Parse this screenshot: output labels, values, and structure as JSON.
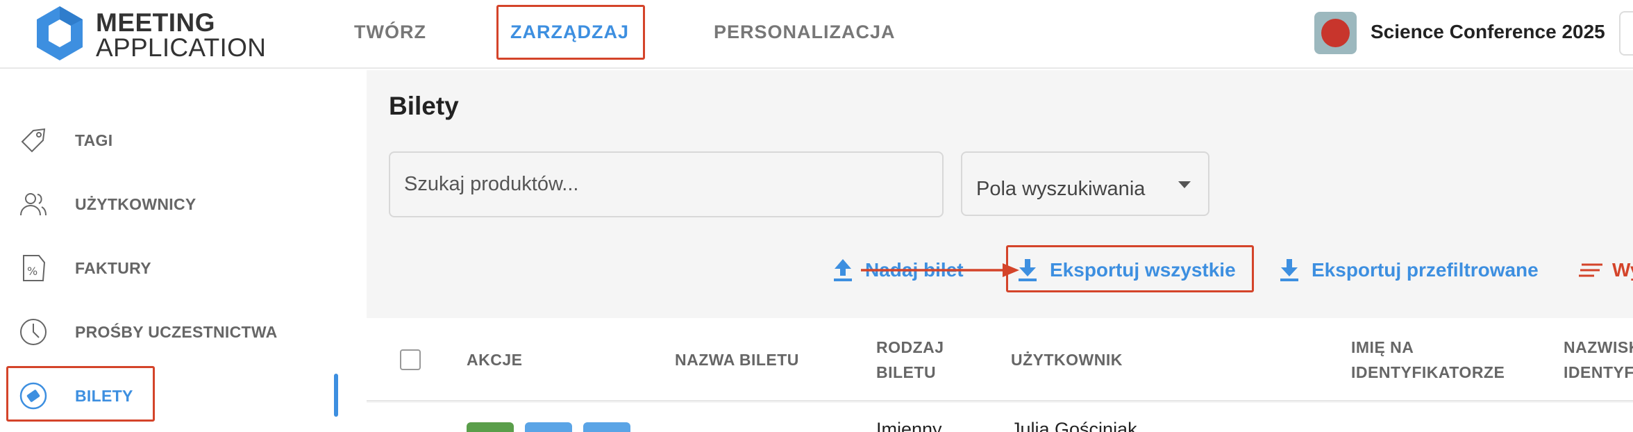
{
  "logo": {
    "line1": "MEETING",
    "line2": "APPLICATION"
  },
  "nav": {
    "tworz": "TWÓRZ",
    "zarzadzaj": "ZARZĄDZAJ",
    "personalizacja": "PERSONALIZACJA"
  },
  "conference": {
    "name": "Science Conference 2025"
  },
  "sidebar": {
    "items": [
      {
        "label": "TAGI",
        "icon": "tag-icon"
      },
      {
        "label": "UŻYTKOWNICY",
        "icon": "users-icon"
      },
      {
        "label": "FAKTURY",
        "icon": "invoice-icon"
      },
      {
        "label": "PROŚBY UCZESTNICTWA",
        "icon": "clock-icon"
      },
      {
        "label": "BILETY",
        "icon": "ticket-icon"
      }
    ]
  },
  "main": {
    "title": "Bilety",
    "search": {
      "placeholder": "Szukaj produktów..."
    },
    "search_fields": {
      "value": "Pola wyszukiwania"
    },
    "actions": {
      "nadaj": "Nadaj bilet",
      "eksportuj_wszystkie": "Eksportuj wszystkie",
      "eksportuj_przefiltrowane": "Eksportuj przefiltrowane",
      "wy": "Wy"
    },
    "table": {
      "headers": {
        "akcje": "AKCJE",
        "nazwa": "NAZWA BILETU",
        "rodzaj_1": "RODZAJ",
        "rodzaj_2": "BILETU",
        "uzytkownik": "UŻYTKOWNIK",
        "imie_1": "IMIĘ NA",
        "imie_2": "IDENTYFIKATORZE",
        "nazwisko_1": "NAZWISK",
        "nazwisko_2": "IDENTYFI"
      },
      "first_row": {
        "rodzaj": "Imienny",
        "uzytkownik": "Julia Gościniak"
      }
    },
    "colors": {
      "accent": "#3d8fe0",
      "highlight": "#d4442a",
      "btn_green": "#5a9e4a",
      "btn_blue": "#5aa4e6"
    }
  }
}
